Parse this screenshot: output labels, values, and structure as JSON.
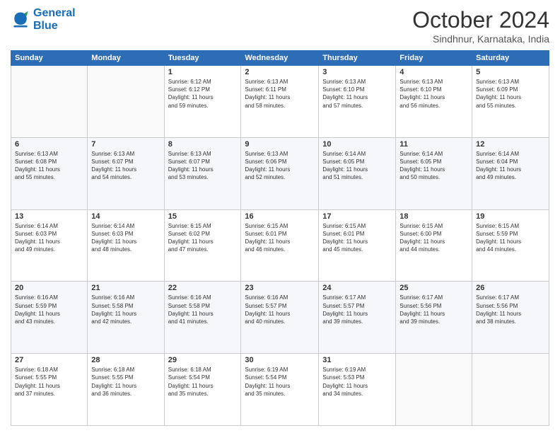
{
  "logo": {
    "line1": "General",
    "line2": "Blue"
  },
  "title": "October 2024",
  "location": "Sindhnur, Karnataka, India",
  "headers": [
    "Sunday",
    "Monday",
    "Tuesday",
    "Wednesday",
    "Thursday",
    "Friday",
    "Saturday"
  ],
  "weeks": [
    [
      {
        "day": "",
        "info": ""
      },
      {
        "day": "",
        "info": ""
      },
      {
        "day": "1",
        "info": "Sunrise: 6:12 AM\nSunset: 6:12 PM\nDaylight: 11 hours\nand 59 minutes."
      },
      {
        "day": "2",
        "info": "Sunrise: 6:13 AM\nSunset: 6:11 PM\nDaylight: 11 hours\nand 58 minutes."
      },
      {
        "day": "3",
        "info": "Sunrise: 6:13 AM\nSunset: 6:10 PM\nDaylight: 11 hours\nand 57 minutes."
      },
      {
        "day": "4",
        "info": "Sunrise: 6:13 AM\nSunset: 6:10 PM\nDaylight: 11 hours\nand 56 minutes."
      },
      {
        "day": "5",
        "info": "Sunrise: 6:13 AM\nSunset: 6:09 PM\nDaylight: 11 hours\nand 55 minutes."
      }
    ],
    [
      {
        "day": "6",
        "info": "Sunrise: 6:13 AM\nSunset: 6:08 PM\nDaylight: 11 hours\nand 55 minutes."
      },
      {
        "day": "7",
        "info": "Sunrise: 6:13 AM\nSunset: 6:07 PM\nDaylight: 11 hours\nand 54 minutes."
      },
      {
        "day": "8",
        "info": "Sunrise: 6:13 AM\nSunset: 6:07 PM\nDaylight: 11 hours\nand 53 minutes."
      },
      {
        "day": "9",
        "info": "Sunrise: 6:13 AM\nSunset: 6:06 PM\nDaylight: 11 hours\nand 52 minutes."
      },
      {
        "day": "10",
        "info": "Sunrise: 6:14 AM\nSunset: 6:05 PM\nDaylight: 11 hours\nand 51 minutes."
      },
      {
        "day": "11",
        "info": "Sunrise: 6:14 AM\nSunset: 6:05 PM\nDaylight: 11 hours\nand 50 minutes."
      },
      {
        "day": "12",
        "info": "Sunrise: 6:14 AM\nSunset: 6:04 PM\nDaylight: 11 hours\nand 49 minutes."
      }
    ],
    [
      {
        "day": "13",
        "info": "Sunrise: 6:14 AM\nSunset: 6:03 PM\nDaylight: 11 hours\nand 49 minutes."
      },
      {
        "day": "14",
        "info": "Sunrise: 6:14 AM\nSunset: 6:03 PM\nDaylight: 11 hours\nand 48 minutes."
      },
      {
        "day": "15",
        "info": "Sunrise: 6:15 AM\nSunset: 6:02 PM\nDaylight: 11 hours\nand 47 minutes."
      },
      {
        "day": "16",
        "info": "Sunrise: 6:15 AM\nSunset: 6:01 PM\nDaylight: 11 hours\nand 46 minutes."
      },
      {
        "day": "17",
        "info": "Sunrise: 6:15 AM\nSunset: 6:01 PM\nDaylight: 11 hours\nand 45 minutes."
      },
      {
        "day": "18",
        "info": "Sunrise: 6:15 AM\nSunset: 6:00 PM\nDaylight: 11 hours\nand 44 minutes."
      },
      {
        "day": "19",
        "info": "Sunrise: 6:15 AM\nSunset: 5:59 PM\nDaylight: 11 hours\nand 44 minutes."
      }
    ],
    [
      {
        "day": "20",
        "info": "Sunrise: 6:16 AM\nSunset: 5:59 PM\nDaylight: 11 hours\nand 43 minutes."
      },
      {
        "day": "21",
        "info": "Sunrise: 6:16 AM\nSunset: 5:58 PM\nDaylight: 11 hours\nand 42 minutes."
      },
      {
        "day": "22",
        "info": "Sunrise: 6:16 AM\nSunset: 5:58 PM\nDaylight: 11 hours\nand 41 minutes."
      },
      {
        "day": "23",
        "info": "Sunrise: 6:16 AM\nSunset: 5:57 PM\nDaylight: 11 hours\nand 40 minutes."
      },
      {
        "day": "24",
        "info": "Sunrise: 6:17 AM\nSunset: 5:57 PM\nDaylight: 11 hours\nand 39 minutes."
      },
      {
        "day": "25",
        "info": "Sunrise: 6:17 AM\nSunset: 5:56 PM\nDaylight: 11 hours\nand 39 minutes."
      },
      {
        "day": "26",
        "info": "Sunrise: 6:17 AM\nSunset: 5:56 PM\nDaylight: 11 hours\nand 38 minutes."
      }
    ],
    [
      {
        "day": "27",
        "info": "Sunrise: 6:18 AM\nSunset: 5:55 PM\nDaylight: 11 hours\nand 37 minutes."
      },
      {
        "day": "28",
        "info": "Sunrise: 6:18 AM\nSunset: 5:55 PM\nDaylight: 11 hours\nand 36 minutes."
      },
      {
        "day": "29",
        "info": "Sunrise: 6:18 AM\nSunset: 5:54 PM\nDaylight: 11 hours\nand 35 minutes."
      },
      {
        "day": "30",
        "info": "Sunrise: 6:19 AM\nSunset: 5:54 PM\nDaylight: 11 hours\nand 35 minutes."
      },
      {
        "day": "31",
        "info": "Sunrise: 6:19 AM\nSunset: 5:53 PM\nDaylight: 11 hours\nand 34 minutes."
      },
      {
        "day": "",
        "info": ""
      },
      {
        "day": "",
        "info": ""
      }
    ]
  ]
}
